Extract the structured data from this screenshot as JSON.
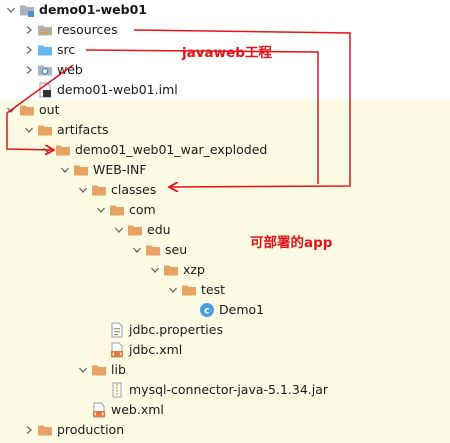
{
  "colors": {
    "folder": "#e8a264",
    "folder_blue": "#66b8e8",
    "out_background": "#fdfbe3",
    "annotation": "#e8121a"
  },
  "tree": {
    "rows": [
      {
        "label": "demo01-web01",
        "bold": true,
        "indent": 0,
        "arrow": "down",
        "icon": "module-folder-icon"
      },
      {
        "label": "resources",
        "indent": 1,
        "arrow": "right",
        "icon": "resources-folder-icon"
      },
      {
        "label": "src",
        "indent": 1,
        "arrow": "right",
        "icon": "source-folder-icon"
      },
      {
        "label": "web",
        "indent": 1,
        "arrow": "right",
        "icon": "web-folder-icon"
      },
      {
        "label": "demo01-web01.iml",
        "indent": 1,
        "arrow": "none",
        "icon": "iml-file-icon"
      },
      {
        "label": "out",
        "indent": 0,
        "arrow": "down",
        "icon": "folder-icon"
      },
      {
        "label": "artifacts",
        "indent": 1,
        "arrow": "down",
        "icon": "folder-icon"
      },
      {
        "label": "demo01_web01_war_exploded",
        "indent": 2,
        "arrow": "down",
        "icon": "folder-icon"
      },
      {
        "label": "WEB-INF",
        "indent": 3,
        "arrow": "down",
        "icon": "folder-icon"
      },
      {
        "label": "classes",
        "indent": 4,
        "arrow": "down",
        "icon": "folder-icon"
      },
      {
        "label": "com",
        "indent": 5,
        "arrow": "down",
        "icon": "folder-icon"
      },
      {
        "label": "edu",
        "indent": 6,
        "arrow": "down",
        "icon": "folder-icon"
      },
      {
        "label": "seu",
        "indent": 7,
        "arrow": "down",
        "icon": "folder-icon"
      },
      {
        "label": "xzp",
        "indent": 8,
        "arrow": "down",
        "icon": "folder-icon"
      },
      {
        "label": "test",
        "indent": 9,
        "arrow": "down",
        "icon": "folder-icon"
      },
      {
        "label": "Demo1",
        "indent": 10,
        "arrow": "none",
        "icon": "class-file-icon"
      },
      {
        "label": "jdbc.properties",
        "indent": 5,
        "arrow": "none",
        "icon": "properties-file-icon"
      },
      {
        "label": "jdbc.xml",
        "indent": 5,
        "arrow": "none",
        "icon": "xml-file-icon"
      },
      {
        "label": "lib",
        "indent": 4,
        "arrow": "down",
        "icon": "folder-icon"
      },
      {
        "label": "mysql-connector-java-5.1.34.jar",
        "indent": 5,
        "arrow": "none",
        "icon": "jar-file-icon"
      },
      {
        "label": "web.xml",
        "indent": 4,
        "arrow": "none",
        "icon": "xml-file-icon"
      },
      {
        "label": "production",
        "indent": 1,
        "arrow": "right",
        "icon": "folder-icon"
      }
    ]
  },
  "annotations": {
    "javaweb_project": "javaweb工程",
    "deployed_app": "可部署的app"
  }
}
